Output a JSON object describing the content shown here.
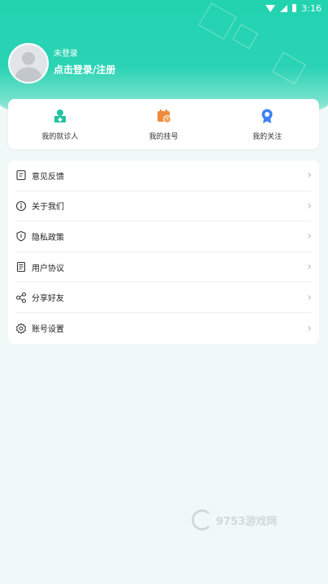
{
  "status_bar": {
    "time": "3:16"
  },
  "profile": {
    "status_text": "未登录",
    "login_text": "点击登录/注册"
  },
  "quick_actions": [
    {
      "label": "我的就诊人",
      "icon": "patient-icon"
    },
    {
      "label": "我的挂号",
      "icon": "appointment-icon"
    },
    {
      "label": "我的关注",
      "icon": "favorite-icon"
    }
  ],
  "menu": [
    {
      "label": "意见反馈",
      "icon": "feedback-icon"
    },
    {
      "label": "关于我们",
      "icon": "info-icon"
    },
    {
      "label": "隐私政策",
      "icon": "shield-icon"
    },
    {
      "label": "用户协议",
      "icon": "document-icon"
    },
    {
      "label": "分享好友",
      "icon": "share-icon"
    },
    {
      "label": "账号设置",
      "icon": "settings-icon"
    }
  ],
  "watermark": {
    "text": "9753游戏网"
  },
  "colors": {
    "accent": "#22d3b0",
    "orange": "#f08a3c",
    "blue": "#3b82f6"
  }
}
